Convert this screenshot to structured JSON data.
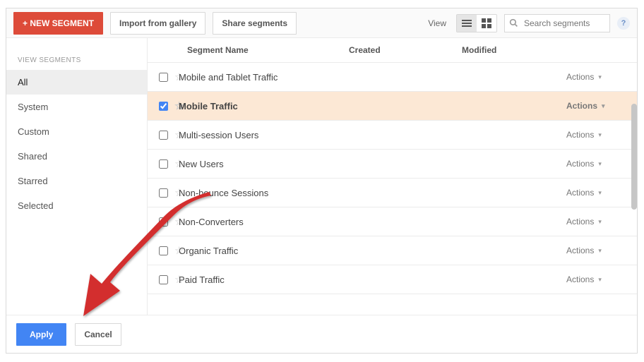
{
  "toolbar": {
    "new_segment_label": "+ NEW SEGMENT",
    "import_label": "Import from gallery",
    "share_label": "Share segments",
    "view_label": "View",
    "search_placeholder": "Search segments",
    "help_label": "?"
  },
  "sidebar": {
    "heading": "VIEW SEGMENTS",
    "items": [
      {
        "label": "All",
        "active": true
      },
      {
        "label": "System",
        "active": false
      },
      {
        "label": "Custom",
        "active": false
      },
      {
        "label": "Shared",
        "active": false
      },
      {
        "label": "Starred",
        "active": false
      },
      {
        "label": "Selected",
        "active": false
      }
    ]
  },
  "table": {
    "headers": {
      "name": "Segment Name",
      "created": "Created",
      "modified": "Modified"
    },
    "actions_label": "Actions",
    "rows": [
      {
        "name": "Mobile and Tablet Traffic",
        "checked": false
      },
      {
        "name": "Mobile Traffic",
        "checked": true
      },
      {
        "name": "Multi-session Users",
        "checked": false
      },
      {
        "name": "New Users",
        "checked": false
      },
      {
        "name": "Non-bounce Sessions",
        "checked": false
      },
      {
        "name": "Non-Converters",
        "checked": false
      },
      {
        "name": "Organic Traffic",
        "checked": false
      },
      {
        "name": "Paid Traffic",
        "checked": false
      }
    ]
  },
  "footer": {
    "apply_label": "Apply",
    "cancel_label": "Cancel"
  },
  "colors": {
    "accent_red": "#dd4b39",
    "accent_blue": "#4285f4",
    "selected_row": "#fce8d5"
  }
}
